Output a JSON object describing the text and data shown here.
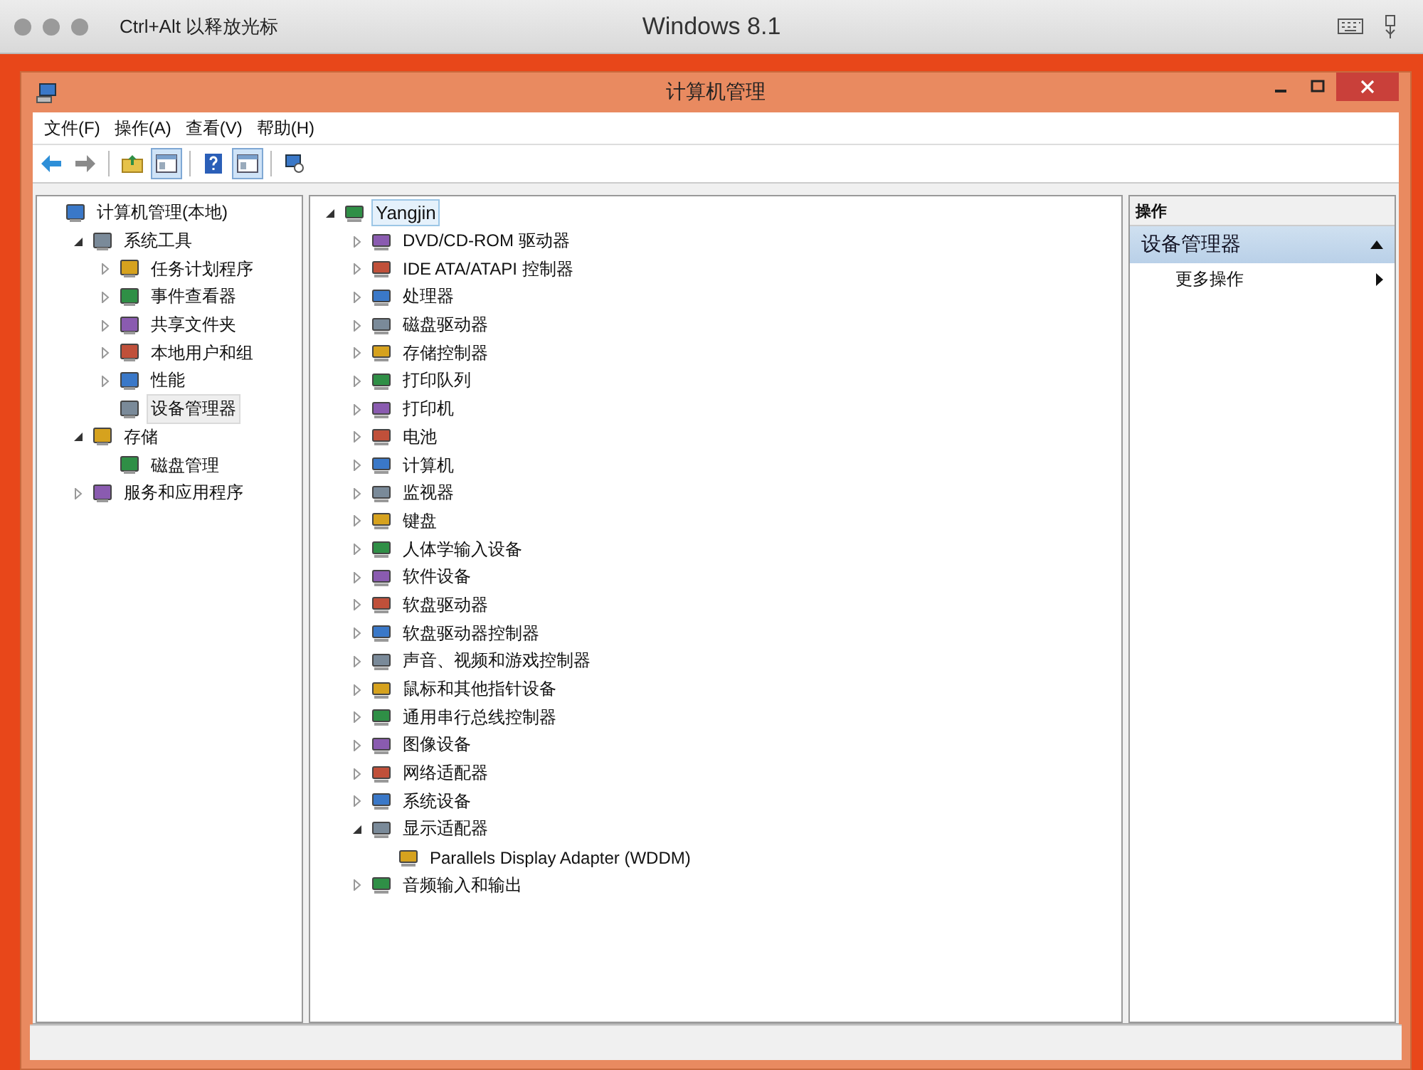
{
  "host_bar": {
    "hint": "Ctrl+Alt 以释放光标",
    "title": "Windows 8.1"
  },
  "window": {
    "title": "计算机管理"
  },
  "menu": [
    "文件(F)",
    "操作(A)",
    "查看(V)",
    "帮助(H)"
  ],
  "toolbar": [
    {
      "pressed": false
    },
    {
      "pressed": false
    },
    {
      "pressed": false
    },
    {
      "pressed": true
    },
    {
      "pressed": false
    },
    {
      "pressed": true
    },
    {
      "pressed": false
    }
  ],
  "console_tree": [
    {
      "label": "计算机管理(本地)",
      "selected": false,
      "children": [
        {
          "label": "系统工具",
          "expanded": true,
          "selected": false,
          "children": [
            {
              "label": "任务计划程序",
              "expanded": false,
              "selected": false
            },
            {
              "label": "事件查看器",
              "expanded": false,
              "selected": false
            },
            {
              "label": "共享文件夹",
              "expanded": false,
              "selected": false
            },
            {
              "label": "本地用户和组",
              "expanded": false,
              "selected": false
            },
            {
              "label": "性能",
              "expanded": false,
              "selected": false
            },
            {
              "label": "设备管理器",
              "selected": true
            }
          ]
        },
        {
          "label": "存储",
          "expanded": true,
          "selected": false,
          "children": [
            {
              "label": "磁盘管理",
              "selected": false
            }
          ]
        },
        {
          "label": "服务和应用程序",
          "expanded": false,
          "selected": false
        }
      ]
    }
  ],
  "device_tree": [
    {
      "label": "Yangjin",
      "expanded": true,
      "selected": true,
      "children": [
        {
          "label": "DVD/CD-ROM 驱动器",
          "expanded": false,
          "selected": false
        },
        {
          "label": "IDE ATA/ATAPI 控制器",
          "expanded": false,
          "selected": false
        },
        {
          "label": "处理器",
          "expanded": false,
          "selected": false
        },
        {
          "label": "磁盘驱动器",
          "expanded": false,
          "selected": false
        },
        {
          "label": "存储控制器",
          "expanded": false,
          "selected": false
        },
        {
          "label": "打印队列",
          "expanded": false,
          "selected": false
        },
        {
          "label": "打印机",
          "expanded": false,
          "selected": false
        },
        {
          "label": "电池",
          "expanded": false,
          "selected": false
        },
        {
          "label": "计算机",
          "expanded": false,
          "selected": false
        },
        {
          "label": "监视器",
          "expanded": false,
          "selected": false
        },
        {
          "label": "键盘",
          "expanded": false,
          "selected": false
        },
        {
          "label": "人体学输入设备",
          "expanded": false,
          "selected": false
        },
        {
          "label": "软件设备",
          "expanded": false,
          "selected": false
        },
        {
          "label": "软盘驱动器",
          "expanded": false,
          "selected": false
        },
        {
          "label": "软盘驱动器控制器",
          "expanded": false,
          "selected": false
        },
        {
          "label": "声音、视频和游戏控制器",
          "expanded": false,
          "selected": false
        },
        {
          "label": "鼠标和其他指针设备",
          "expanded": false,
          "selected": false
        },
        {
          "label": "通用串行总线控制器",
          "expanded": false,
          "selected": false
        },
        {
          "label": "图像设备",
          "expanded": false,
          "selected": false
        },
        {
          "label": "网络适配器",
          "expanded": false,
          "selected": false
        },
        {
          "label": "系统设备",
          "expanded": false,
          "selected": false
        },
        {
          "label": "显示适配器",
          "expanded": true,
          "selected": false,
          "children": [
            {
              "label": "Parallels Display Adapter (WDDM)",
              "selected": false
            }
          ]
        },
        {
          "label": "音频输入和输出",
          "expanded": false,
          "selected": false
        }
      ]
    }
  ],
  "actions": {
    "header": "操作",
    "sections": [
      {
        "title": "设备管理器",
        "expanded": true,
        "items": [
          "更多操作"
        ]
      }
    ]
  }
}
